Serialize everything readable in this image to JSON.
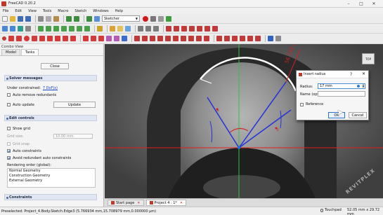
{
  "window": {
    "title": "FreeCAD 0.20.2",
    "min": "–",
    "max": "□",
    "close": "✕"
  },
  "menu": [
    "File",
    "Edit",
    "View",
    "Tools",
    "Macro",
    "Sketch",
    "Windows",
    "Help"
  ],
  "toolbar": {
    "workbench": "Sketcher"
  },
  "combo_view": {
    "title": "Combo View",
    "tabs": [
      "Model",
      "Tasks"
    ],
    "close_button": "Close",
    "solver": {
      "header": "Solver messages",
      "under_constrained_label": "Under constrained:",
      "under_constrained_link": "7 DoF(s)",
      "auto_remove_redundants": "Auto remove redundants",
      "auto_update": "Auto update",
      "update_button": "Update"
    },
    "edit_controls": {
      "header": "Edit controls",
      "show_grid": "Show grid",
      "grid_size_label": "Grid size:",
      "grid_size_value": "10.00 mm",
      "grid_snap": "Grid snap",
      "auto_constraints": "Auto constraints",
      "avoid_redundant": "Avoid redundant auto constraints",
      "rendering_order_label": "Rendering order (global):",
      "rendering_order": [
        "Normal Geometry",
        "Construction Geometry",
        "External Geometry"
      ]
    },
    "constraints": {
      "header": "Constraints"
    }
  },
  "viewport": {
    "dimension_label": "56.732 mm",
    "navcube_label": "TOP",
    "watermark": "REVITPLEX"
  },
  "dialog": {
    "title": "Insert radius",
    "help": "?",
    "close": "✕",
    "radius_label": "Radius:",
    "radius_value": "17 mm",
    "name_label": "Name (optional)",
    "reference_label": "Reference",
    "ok": "OK",
    "cancel": "Cancel"
  },
  "doc_tabs": [
    "Start page",
    "Project 4 : 1*"
  ],
  "status": {
    "preselected": "Preselected: Project_4.Body.Sketch.Edge3 (5.766934 mm,15.708979 mm,0.000000 µm)",
    "navigation": "Touchpad",
    "dimensions": "52.05 mm x 29.72 mm"
  },
  "colors": {
    "accent": "#2d72c9",
    "section_header": "#dfe6f1",
    "axis_red": "#e0211f",
    "axis_green": "#35c035",
    "sketch_blue": "#2333d8",
    "constraint_red": "#d42020"
  }
}
